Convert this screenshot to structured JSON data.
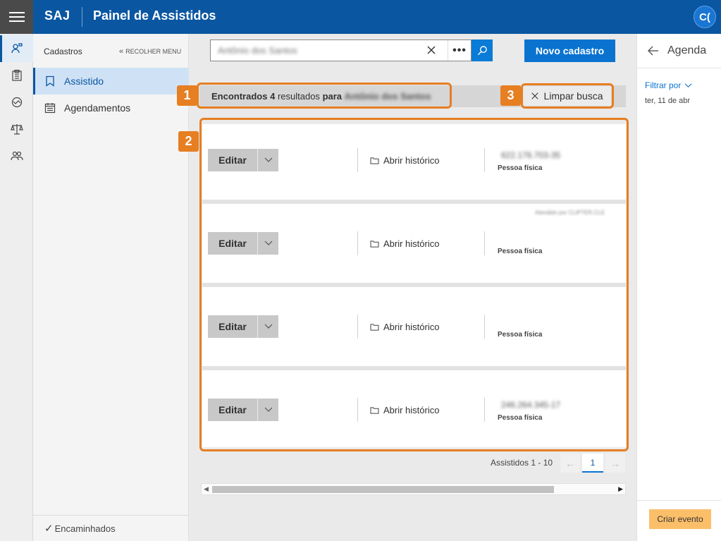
{
  "header": {
    "brand": "SAJ",
    "title": "Painel de Assistidos",
    "user_initials": "C("
  },
  "sidebar": {
    "heading": "Cadastros",
    "collapse_label": "RECOLHER MENU",
    "items": [
      {
        "label": "Assistido",
        "icon": "bookmark-icon",
        "active": true
      },
      {
        "label": "Agendamentos",
        "icon": "calendar-icon",
        "active": false
      }
    ],
    "footer_label": "Encaminhados"
  },
  "rail": {
    "icons": [
      "person-icon",
      "clipboard-icon",
      "handshake-icon",
      "scales-icon",
      "people-icon"
    ]
  },
  "search": {
    "value": "Antônio dos Santos",
    "more_label": "•••",
    "new_button": "Novo cadastro"
  },
  "results": {
    "prefix": "Encontrados",
    "count": "4",
    "middle": "resultados",
    "for_word": "para",
    "query": "Antônio dos Santos",
    "clear_label": "Limpar busca"
  },
  "callouts": [
    "1",
    "2",
    "3"
  ],
  "cards": [
    {
      "edit": "Editar",
      "history": "Abrir histórico",
      "doc": "622.176.703-35",
      "type": "Pessoa física",
      "note": ""
    },
    {
      "edit": "Editar",
      "history": "Abrir histórico",
      "doc": "",
      "type": "Pessoa física",
      "note": "Atendido por CLIPTER.CLE"
    },
    {
      "edit": "Editar",
      "history": "Abrir histórico",
      "doc": "",
      "type": "Pessoa física",
      "note": ""
    },
    {
      "edit": "Editar",
      "history": "Abrir histórico",
      "doc": "246.264.345-17",
      "type": "Pessoa física",
      "note": ""
    }
  ],
  "pager": {
    "label": "Assistidos 1 - 10",
    "current_page": "1"
  },
  "agenda": {
    "title": "Agenda",
    "filter_label": "Filtrar por",
    "date": "ter, 11 de abr",
    "create_button": "Criar evento"
  },
  "colors": {
    "header": "#0a56a1",
    "accent": "#0a73d0",
    "callout": "#e67e22",
    "create_button": "#fbbf6a"
  }
}
